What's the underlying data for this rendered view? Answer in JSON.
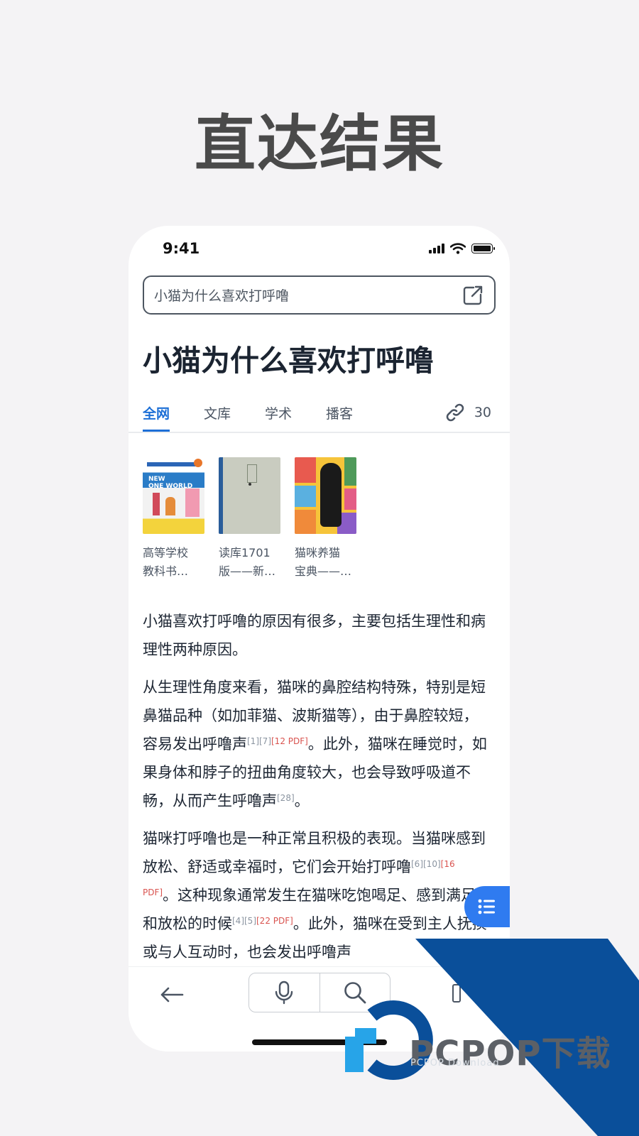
{
  "headline": "直达结果",
  "status": {
    "time": "9:41"
  },
  "search": {
    "query": "小猫为什么喜欢打呼噜"
  },
  "page_title": "小猫为什么喜欢打呼噜",
  "tabs": [
    {
      "label": "全网",
      "active": true
    },
    {
      "label": "文库",
      "active": false
    },
    {
      "label": "学术",
      "active": false
    },
    {
      "label": "播客",
      "active": false
    }
  ],
  "source_count": "30",
  "books": [
    {
      "line1": "高等学校",
      "line2": "教科书…"
    },
    {
      "line1": "读库1701",
      "line2": "版——新…"
    },
    {
      "line1": "猫咪养猫",
      "line2": "宝典——…"
    }
  ],
  "article": {
    "p1": "小猫喜欢打呼噜的原因有很多，主要包括生理性和病理性两种原因。",
    "p2a": "从生理性角度来看，猫咪的鼻腔结构特殊，特别是短鼻猫品种（如加菲猫、波斯猫等），由于鼻腔较短，容易发出呼噜声",
    "p2_ref1": "[1][7]",
    "p2_pdf1": "[12 PDF]",
    "p2b": "。此外，猫咪在睡觉时，如果身体和脖子的扭曲角度较大，也会导致呼吸道不畅，从而产生呼噜声",
    "p2_ref2": "[28]",
    "p2c": "。",
    "p3a": "猫咪打呼噜也是一种正常且积极的表现。当猫咪感到放松、舒适或幸福时，它们会开始打呼噜",
    "p3_ref1": "[6][10]",
    "p3_pdf1": "[16 PDF]",
    "p3b": "。这种现象通常发生在猫咪吃饱喝足、感到满足和放松的时候",
    "p3_ref2": "[4][5]",
    "p3_pdf2": "[22 PDF]",
    "p3c": "。此外，猫咪在受到主人抚摸或与人互动时，也会发出呼噜声"
  },
  "watermark": {
    "brand": "PCPOP下载",
    "sub": "PCPOP Download"
  },
  "colors": {
    "accent": "#1d6fd6",
    "fab": "#2f7bf0",
    "pdf_ref": "#d9534f",
    "watermark_blue": "#0a4f9a"
  },
  "icons": {
    "share": "share-external-icon",
    "link": "link-icon",
    "fab": "list-icon",
    "back": "arrow-left-icon",
    "mic": "microphone-icon",
    "search": "search-icon"
  }
}
